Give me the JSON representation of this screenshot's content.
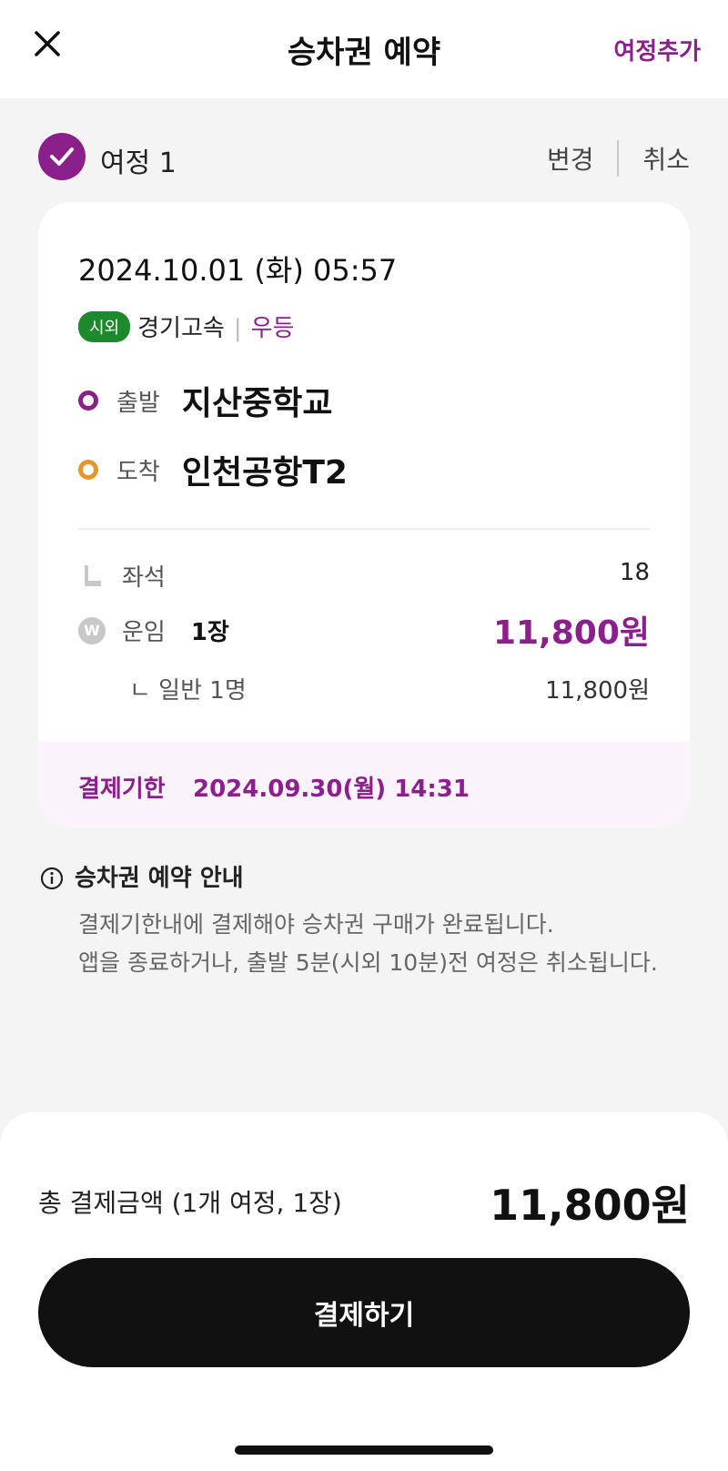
{
  "header": {
    "title": "승차권 예약",
    "add_journey": "여정추가"
  },
  "journey": {
    "label": "여정 1",
    "change": "변경",
    "cancel": "취소"
  },
  "ticket": {
    "datetime": "2024.10.01 (화) 05:57",
    "badge": "시외",
    "company": "경기고속",
    "separator": "|",
    "grade": "우등",
    "departure": {
      "label": "출발",
      "name": "지산중학교"
    },
    "arrival": {
      "label": "도착",
      "name": "인천공항T2"
    },
    "seat": {
      "label": "좌석",
      "value": "18"
    },
    "fare": {
      "label": "운임",
      "count": "1장",
      "price": "11,800원",
      "icon": "W"
    },
    "fare_detail": {
      "label": "ㄴ 일반 1명",
      "price": "11,800원"
    },
    "deadline": {
      "label": "결제기한",
      "value": "2024.09.30(월) 14:31"
    }
  },
  "notice": {
    "title": "승차권 예약 안내",
    "line1": "결제기한내에 결제해야 승차권 구매가 완료됩니다.",
    "line2": "앱을 종료하거나, 출발 5분(시외 10분)전 여정은 취소됩니다."
  },
  "footer": {
    "total_label": "총 결제금액 (1개 여정, 1장)",
    "total_amount": "11,800원",
    "pay_button": "결제하기"
  },
  "colors": {
    "accent": "#8b1f8c",
    "badge": "#1c8a2c",
    "arrival_dot": "#e6962a",
    "button": "#111111"
  },
  "icons": {
    "close": "close-icon",
    "check": "check-icon",
    "seat": "seat-icon",
    "won": "won-icon",
    "info": "info-icon"
  }
}
